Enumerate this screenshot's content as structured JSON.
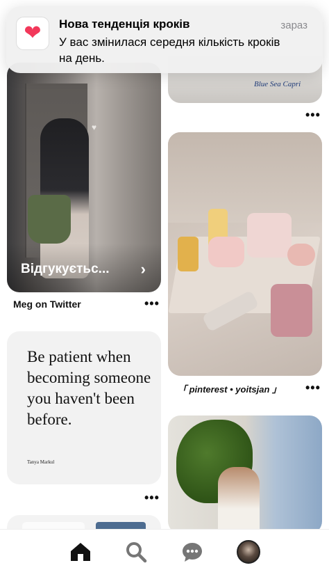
{
  "notification": {
    "title": "Нова тенденція кроків",
    "time": "зараз",
    "body": "У вас змінилася середня кількість кроків на день.",
    "icon": "heart-icon",
    "accent_color": "#f2385a"
  },
  "feed": {
    "left": [
      {
        "caption": "Відгукуєтьс...",
        "source": "Meg on Twitter"
      },
      {
        "quote": "Be patient when becoming someone you haven't been before.",
        "author": "Tanya Markul"
      }
    ],
    "right": [
      {
        "text": "Blue Sea Capri"
      },
      {
        "source": "「 pinterest • yoitsjan 」"
      }
    ]
  },
  "tabbar": {
    "items": [
      "home-icon",
      "search-icon",
      "messages-icon",
      "profile-avatar"
    ],
    "active": "home"
  }
}
